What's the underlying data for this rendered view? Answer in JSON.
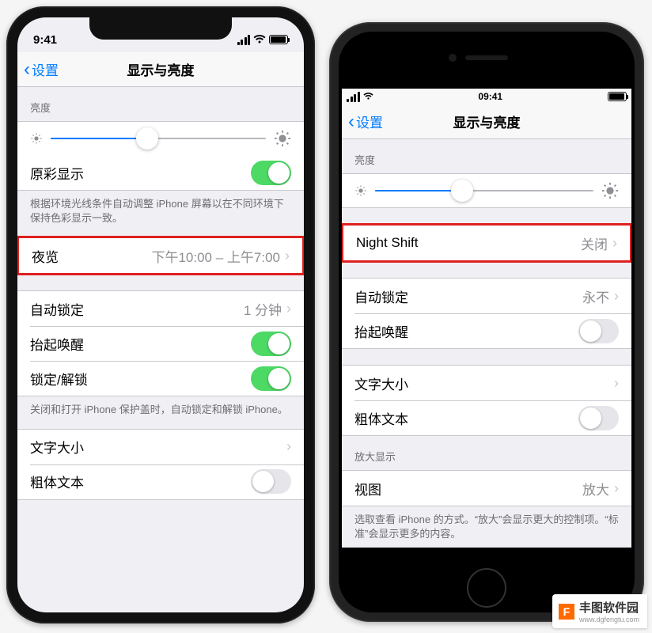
{
  "phoneX": {
    "status": {
      "time": "9:41"
    },
    "nav": {
      "back": "设置",
      "title": "显示与亮度"
    },
    "brightness": {
      "header": "亮度",
      "percent": 45
    },
    "trueTone": {
      "label": "原彩显示",
      "on": true,
      "footer": "根据环境光线条件自动调整 iPhone 屏幕以在不同环境下保持色彩显示一致。"
    },
    "nightShift": {
      "label": "夜览",
      "detail": "下午10:00 – 上午7:00"
    },
    "autoLock": {
      "label": "自动锁定",
      "detail": "1 分钟"
    },
    "raiseToWake": {
      "label": "抬起唤醒",
      "on": true
    },
    "lockUnlock": {
      "label": "锁定/解锁",
      "on": true,
      "footer": "关闭和打开 iPhone 保护盖时，自动锁定和解锁 iPhone。"
    },
    "textSize": {
      "label": "文字大小"
    },
    "bold": {
      "label": "粗体文本",
      "on": false
    }
  },
  "phone8": {
    "status": {
      "time": "09:41"
    },
    "nav": {
      "back": "设置",
      "title": "显示与亮度"
    },
    "brightness": {
      "header": "亮度",
      "percent": 40
    },
    "nightShift": {
      "label": "Night Shift",
      "detail": "关闭"
    },
    "autoLock": {
      "label": "自动锁定",
      "detail": "永不"
    },
    "raiseToWake": {
      "label": "抬起唤醒",
      "on": false
    },
    "textSize": {
      "label": "文字大小"
    },
    "bold": {
      "label": "粗体文本",
      "on": false
    },
    "zoom": {
      "header": "放大显示",
      "label": "视图",
      "detail": "放大",
      "footer": "选取查看 iPhone 的方式。“放大”会显示更大的控制项。“标准”会显示更多的内容。"
    }
  },
  "watermark": {
    "name": "丰图软件园",
    "url": "www.dgfengtu.com",
    "logo": "F"
  }
}
